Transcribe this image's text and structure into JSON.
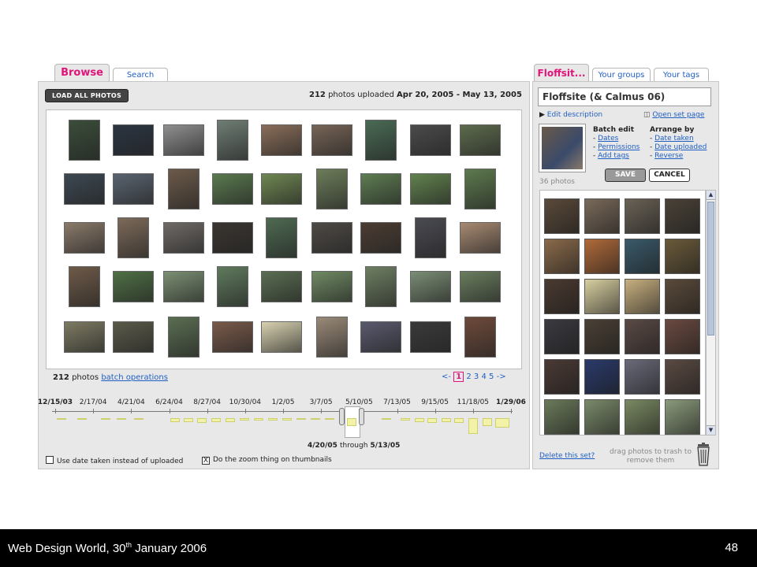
{
  "left": {
    "tabs": {
      "browse": "Browse",
      "search": "Search"
    },
    "load_all": "LOAD ALL PHOTOS",
    "count": "212",
    "uploaded_text": "photos uploaded",
    "date_range": "Apr 20, 2005 - May 13, 2005",
    "footer_count": "212",
    "footer_photos": "photos",
    "batch_ops": "batch operations",
    "pager": {
      "prev": "<-",
      "pages": [
        "1",
        "2",
        "3",
        "4",
        "5"
      ],
      "next": "->"
    },
    "timeline_labels": [
      "12/15/03",
      "2/17/04",
      "4/21/04",
      "6/24/04",
      "8/27/04",
      "10/30/04",
      "1/2/05",
      "3/7/05",
      "5/10/05",
      "7/13/05",
      "9/15/05",
      "11/18/05",
      "1/29/06"
    ],
    "range_from": "4/20/05",
    "range_through": "through",
    "range_to": "5/13/05",
    "opt_date_taken": "Use date taken instead of uploaded",
    "opt_zoom": "Do the zoom thing on thumbnails",
    "opt_zoom_checked": "X",
    "thumb_colors": [
      [
        "#3a4d3a",
        "#2b3542",
        "#8f8f8f",
        "#6f7d74",
        "#8a6e5a",
        "#776456",
        "#4a6b55",
        "#4b4b4b",
        "#5d6b4d"
      ],
      [
        "#3d4852",
        "#5a6470",
        "#6c5a4a",
        "#5a7a4f",
        "#6f8752",
        "#6d7d5a",
        "#5e7d52",
        "#61824e",
        "#5d7a4e"
      ],
      [
        "#8a7a6a",
        "#7d6a5a",
        "#6f6a66",
        "#3a3530",
        "#4e6a52",
        "#4e4a45",
        "#4b3d33",
        "#4a4a52",
        "#a88a72"
      ],
      [
        "#6e5a48",
        "#4f7045",
        "#7b8f72",
        "#5f7a5d",
        "#5a6e52",
        "#6f8a63",
        "#6d7e62",
        "#7a8d74",
        "#6a7d5e"
      ],
      [
        "#7d7a62",
        "#5a5a4a",
        "#5a6e52",
        "#7a5a4a",
        "#d8d2b0",
        "#9a8a78",
        "#5a5a6e",
        "#3a3a3a",
        "#6e4a3a"
      ]
    ]
  },
  "right": {
    "tabs": {
      "set": "Floffsit...",
      "groups": "Your groups",
      "tags": "Your tags"
    },
    "title_value": "Floffsite (& Calmus 06)",
    "edit_desc": "Edit description",
    "open_set": "Open set page",
    "batch_edit": "Batch edit",
    "batch_items": [
      "Dates",
      "Permissions",
      "Add tags"
    ],
    "arrange_by": "Arrange by",
    "arrange_items": [
      "Date taken",
      "Date uploaded",
      "Reverse"
    ],
    "photo_count": "36 photos",
    "save": "SAVE",
    "cancel": "CANCEL",
    "delete_set": "Delete this set?",
    "drag_hint": "drag photos to trash to remove them",
    "thumb_colors": [
      [
        "#5a4a3a",
        "#7a6a5a",
        "#6a6256",
        "#4a4238"
      ],
      [
        "#8a6a4a",
        "#b06a3a",
        "#3a5a6a",
        "#6a5a3a"
      ],
      [
        "#4a3a30",
        "#d8cfa0",
        "#c8b080",
        "#5a4a3a"
      ],
      [
        "#3a3a40",
        "#4a4035",
        "#5a4a45",
        "#6a4a40"
      ],
      [
        "#4a3a35",
        "#2a3a6a",
        "#6a6a7a",
        "#5a4a42"
      ],
      [
        "#6a7a5a",
        "#7a8a6a",
        "#7a8a62",
        "#8a9a7a"
      ]
    ]
  },
  "slide_footer": {
    "title": "Web Design World, 30",
    "sup": "th",
    "rest": " January 2006",
    "page": "48"
  }
}
